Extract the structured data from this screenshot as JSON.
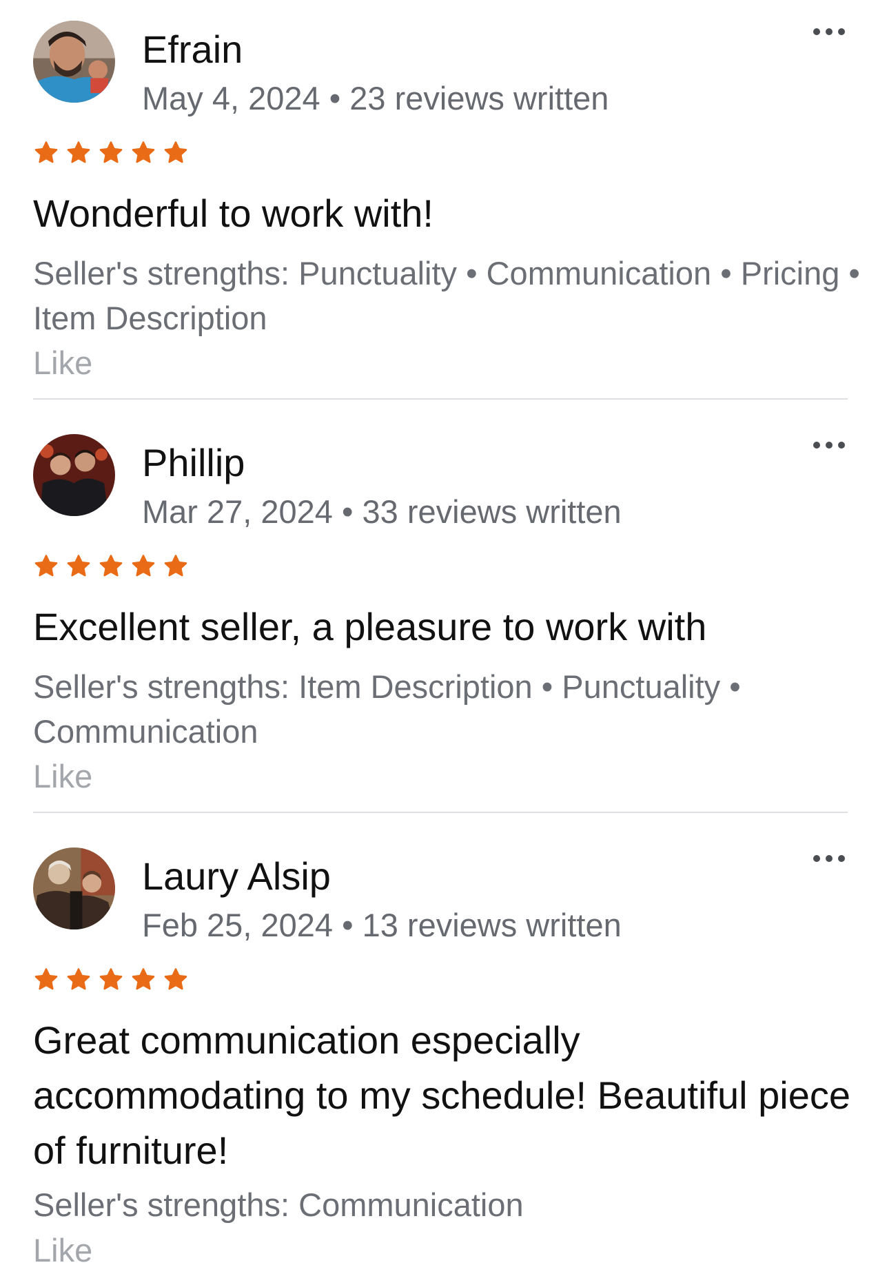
{
  "accent_color": "#e96b16",
  "reviews": [
    {
      "name": "Efrain",
      "date": "May 4, 2024",
      "separator": "•",
      "reviews_written": "23 reviews written",
      "rating": 5,
      "title": "Wonderful to work with!",
      "strengths": "Seller's strengths: Punctuality • Communication • Pricing • Item Description",
      "like_label": "Like",
      "avatar_icon": "user-photo-avatar",
      "more_icon": "more-options-icon"
    },
    {
      "name": "Phillip",
      "date": "Mar 27, 2024",
      "separator": "•",
      "reviews_written": "33 reviews written",
      "rating": 5,
      "title": "Excellent seller, a pleasure to work with",
      "strengths": "Seller's strengths: Item Description • Punctuality • Communication",
      "like_label": "Like",
      "avatar_icon": "user-photo-avatar",
      "more_icon": "more-options-icon"
    },
    {
      "name": "Laury Alsip",
      "date": "Feb 25, 2024",
      "separator": "•",
      "reviews_written": "13 reviews written",
      "rating": 5,
      "title": "Great communication especially accommodating to my schedule! Beautiful piece of furniture!",
      "strengths": "Seller's strengths: Communication",
      "like_label": "Like",
      "avatar_icon": "user-photo-avatar",
      "more_icon": "more-options-icon"
    }
  ]
}
